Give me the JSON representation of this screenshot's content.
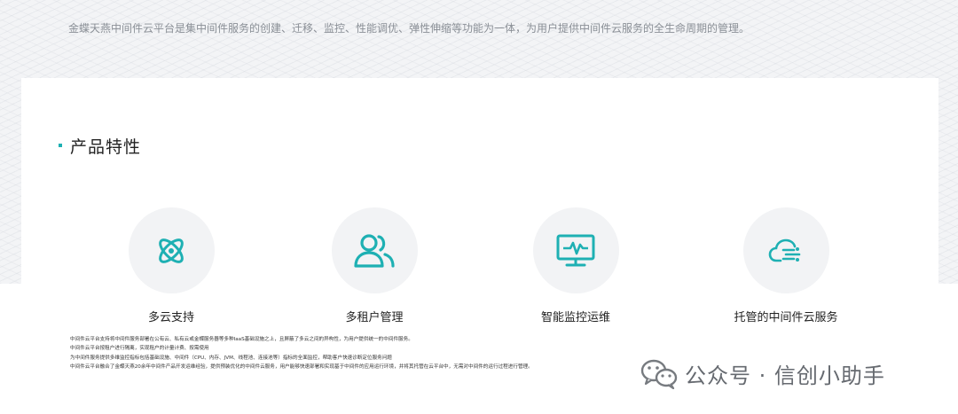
{
  "intro": {
    "text": "金蝶天燕中间件云平台是集中间件服务的创建、迁移、监控、性能调优、弹性伸缩等功能为一体，为用户提供中间件云服务的全生命周期的管理。"
  },
  "section": {
    "title": "产品特性"
  },
  "features": [
    {
      "label": "多云支持",
      "icon": "atom-icon"
    },
    {
      "label": "多租户管理",
      "icon": "users-icon"
    },
    {
      "label": "智能监控运维",
      "icon": "monitor-chart-icon"
    },
    {
      "label": "托管的中间件云服务",
      "icon": "cloud-icon"
    }
  ],
  "descriptions": [
    "中间件云平台支持将中间件服务部署在公有云、私有云或金蝶服务器等多种IaaS基础设施之上，且屏蔽了多云之间的异构性，为用户提供统一的中间件服务。",
    "中间件云平台按租户进行隔离，实现租户的计量计费、按需使用",
    "为中间件服务提供多维监控指标包括基础设施、中间件（CPU、内存、JVM、线程池、连接池等）指标的全面监控，帮助客户快速诊断定位服务问题",
    "中间件云平台融合了金蝶天燕20余年中间件产品开发运维经验，提供预装优化的中间件云服务，用户能够快速部署和实现基于中间件的应用运行环境，并将其托管在云平台中，无需对中间件的运行过程进行管理。"
  ],
  "watermark": {
    "text": "公众号 · 信创小助手",
    "icon": "wechat-icon"
  },
  "colors": {
    "accent": "#1eb0b3"
  }
}
